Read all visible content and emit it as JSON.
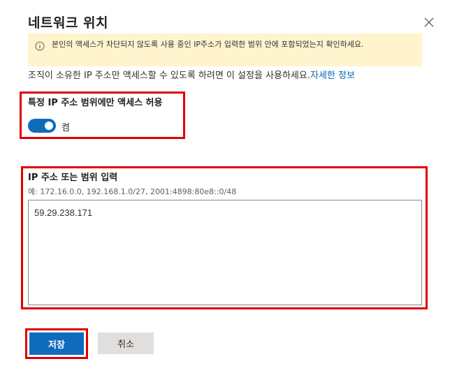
{
  "dialog": {
    "title": "네트워크 위치"
  },
  "banner": {
    "text": "본인의 액세스가 차단되지 않도록 사용 중인 IP주소가 입력한 범위 안에 포함되었는지 확인하세요."
  },
  "description": {
    "text": "조직이 소유한 IP 주소만 액세스할 수 있도록 하려면 이 설정을 사용하세요.",
    "link": "자세한 정보"
  },
  "toggle": {
    "label": "특정 IP 주소 범위에만 액세스 허용",
    "state_label": "켬",
    "on": true
  },
  "ip_input": {
    "label": "IP 주소 또는 범위 입력",
    "hint": "예: 172.16.0.0, 192.168.1.0/27, 2001:4898:80e8::0/48",
    "value": "59.29.238.171"
  },
  "buttons": {
    "save": "저장",
    "cancel": "취소"
  },
  "colors": {
    "accent": "#0f6cbd",
    "banner_bg": "#fff4ce",
    "highlight": "#e00000"
  }
}
